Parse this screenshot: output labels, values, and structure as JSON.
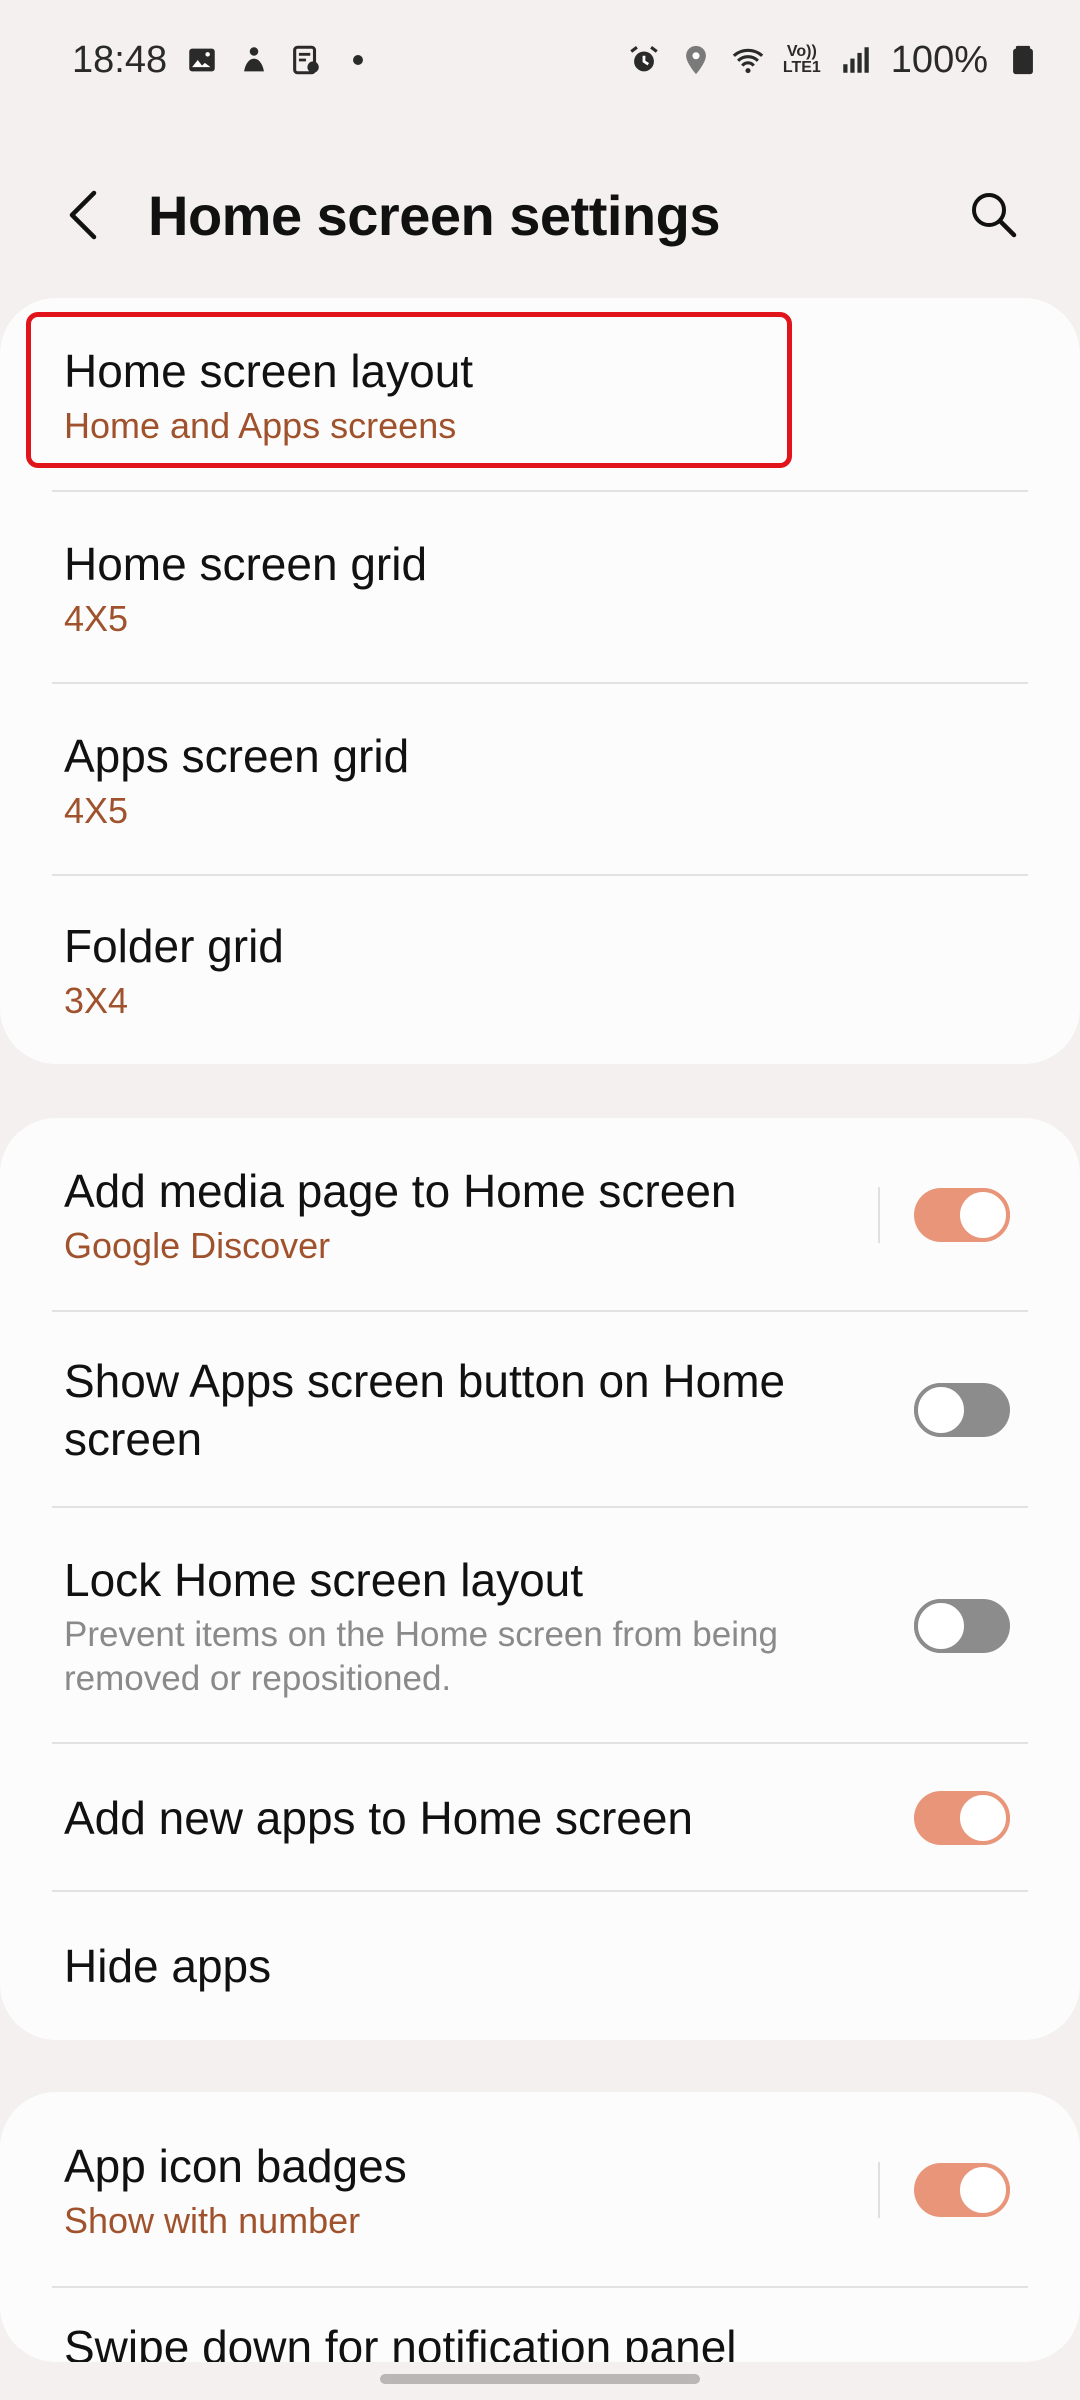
{
  "status_bar": {
    "time": "18:48",
    "left_icons": [
      "gallery-icon",
      "bixby-icon",
      "notes-icon",
      "dot-icon"
    ],
    "right_icons": [
      "alarm-icon",
      "location-icon",
      "wifi-icon",
      "volte-icon",
      "signal-icon"
    ],
    "volte_top": "Vo))",
    "volte_bottom": "LTE1",
    "battery": "100%"
  },
  "header": {
    "title": "Home screen settings"
  },
  "cards": [
    {
      "rows": [
        {
          "title": "Home screen layout",
          "sub": "Home and Apps screens"
        },
        {
          "title": "Home screen grid",
          "sub": "4X5"
        },
        {
          "title": "Apps screen grid",
          "sub": "4X5"
        },
        {
          "title": "Folder grid",
          "sub": "3X4"
        }
      ]
    },
    {
      "rows": [
        {
          "title": "Add media page to Home screen",
          "sub": "Google Discover",
          "toggle": "on"
        },
        {
          "title": "Show Apps screen button on Home screen",
          "toggle": "off"
        },
        {
          "title": "Lock Home screen layout",
          "desc": "Prevent items on the Home screen from being removed or repositioned.",
          "toggle": "off"
        },
        {
          "title": "Add new apps to Home screen",
          "toggle": "on"
        },
        {
          "title": "Hide apps"
        }
      ]
    },
    {
      "rows": [
        {
          "title": "App icon badges",
          "sub": "Show with number",
          "toggle": "on"
        },
        {
          "title": "Swipe down for notification panel"
        }
      ]
    }
  ],
  "colors": {
    "background": "#f4f0ef",
    "card": "#fcfcfc",
    "accent_sub": "#a0522d",
    "toggle_on": "#e8957a",
    "toggle_off": "#8c8c8c",
    "highlight": "#e0141a"
  }
}
